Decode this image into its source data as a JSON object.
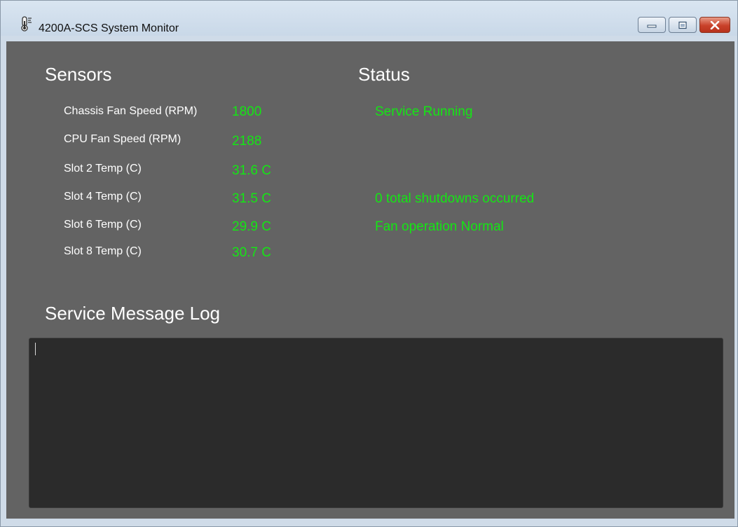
{
  "window": {
    "title": "4200A-SCS System Monitor",
    "icon": "thermometer-icon",
    "caption_icons": [
      "minimize-icon",
      "maximize-icon",
      "close-icon"
    ]
  },
  "sensors": {
    "heading": "Sensors",
    "items": [
      {
        "label": "Chassis Fan Speed (RPM)",
        "value": "1800"
      },
      {
        "label": "CPU Fan Speed (RPM)",
        "value": "2188"
      },
      {
        "label": "Slot 2 Temp (C)",
        "value": "31.6 C"
      },
      {
        "label": "Slot 4 Temp (C)",
        "value": "31.5 C"
      },
      {
        "label": "Slot 6 Temp (C)",
        "value": "29.9 C"
      },
      {
        "label": "Slot 8 Temp (C)",
        "value": "30.7 C"
      }
    ]
  },
  "status": {
    "heading": "Status",
    "service": "Service Running",
    "shutdowns": "0 total shutdowns occurred",
    "fan": "Fan operation Normal"
  },
  "log": {
    "heading": "Service Message Log",
    "content": ""
  },
  "colors": {
    "background": "#636363",
    "value_green": "#14e614",
    "log_background": "#2b2b2b"
  }
}
